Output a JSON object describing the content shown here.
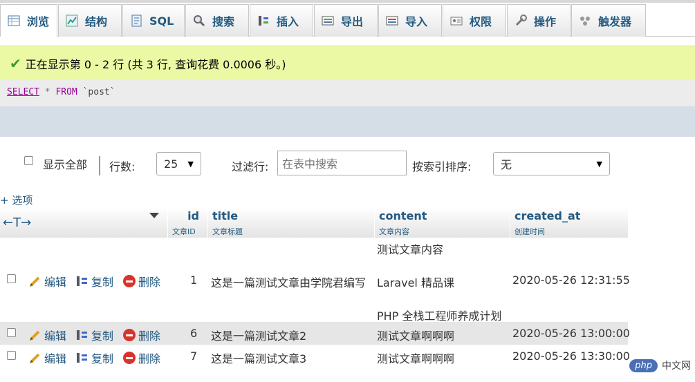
{
  "tabs": [
    {
      "label": "浏览",
      "icon": "browse-icon",
      "active": true
    },
    {
      "label": "结构",
      "icon": "structure-icon"
    },
    {
      "label": "SQL",
      "icon": "sql-icon"
    },
    {
      "label": "搜索",
      "icon": "search-icon"
    },
    {
      "label": "插入",
      "icon": "insert-icon"
    },
    {
      "label": "导出",
      "icon": "export-icon"
    },
    {
      "label": "导入",
      "icon": "import-icon"
    },
    {
      "label": "权限",
      "icon": "privileges-icon"
    },
    {
      "label": "操作",
      "icon": "wrench-icon"
    },
    {
      "label": "触发器",
      "icon": "triggers-icon"
    }
  ],
  "message": {
    "text": "正在显示第 0 - 2 行 (共 3 行, 查询花费 0.0006 秒。)",
    "icon": "check-icon"
  },
  "sql": {
    "select": "SELECT",
    "star": "*",
    "from": "FROM",
    "table": "`post`"
  },
  "nav": {
    "show_all": "显示全部",
    "rows_label": "行数:",
    "rows_value": "25",
    "filter_label": "过滤行:",
    "filter_placeholder": "在表中搜索",
    "sort_label": "按索引排序:",
    "sort_value": "无"
  },
  "options_link": "+ 选项",
  "table": {
    "col_control": "←T→",
    "columns": [
      {
        "name": "id",
        "comment": "文章ID"
      },
      {
        "name": "title",
        "comment": "文章标题"
      },
      {
        "name": "content",
        "comment": "文章内容"
      },
      {
        "name": "created_at",
        "comment": "创建时间"
      }
    ],
    "actions": {
      "edit": "编辑",
      "copy": "复制",
      "delete": "删除"
    },
    "rows": [
      {
        "id": "1",
        "title": "这是一篇测试文章由学院君编写",
        "content_lines": [
          "测试文章内容",
          "Laravel 精品课",
          "PHP 全栈工程师养成计划"
        ],
        "created_at": "2020-05-26 12:31:55"
      },
      {
        "id": "6",
        "title": "这是一篇测试文章2",
        "content_lines": [
          "测试文章啊啊啊"
        ],
        "created_at": "2020-05-26 13:00:00"
      },
      {
        "id": "7",
        "title": "这是一篇测试文章3",
        "content_lines": [
          "测试文章啊啊啊"
        ],
        "created_at": "2020-05-26 13:30:00"
      }
    ]
  },
  "watermark": {
    "logo": "php",
    "text": "中文网"
  }
}
